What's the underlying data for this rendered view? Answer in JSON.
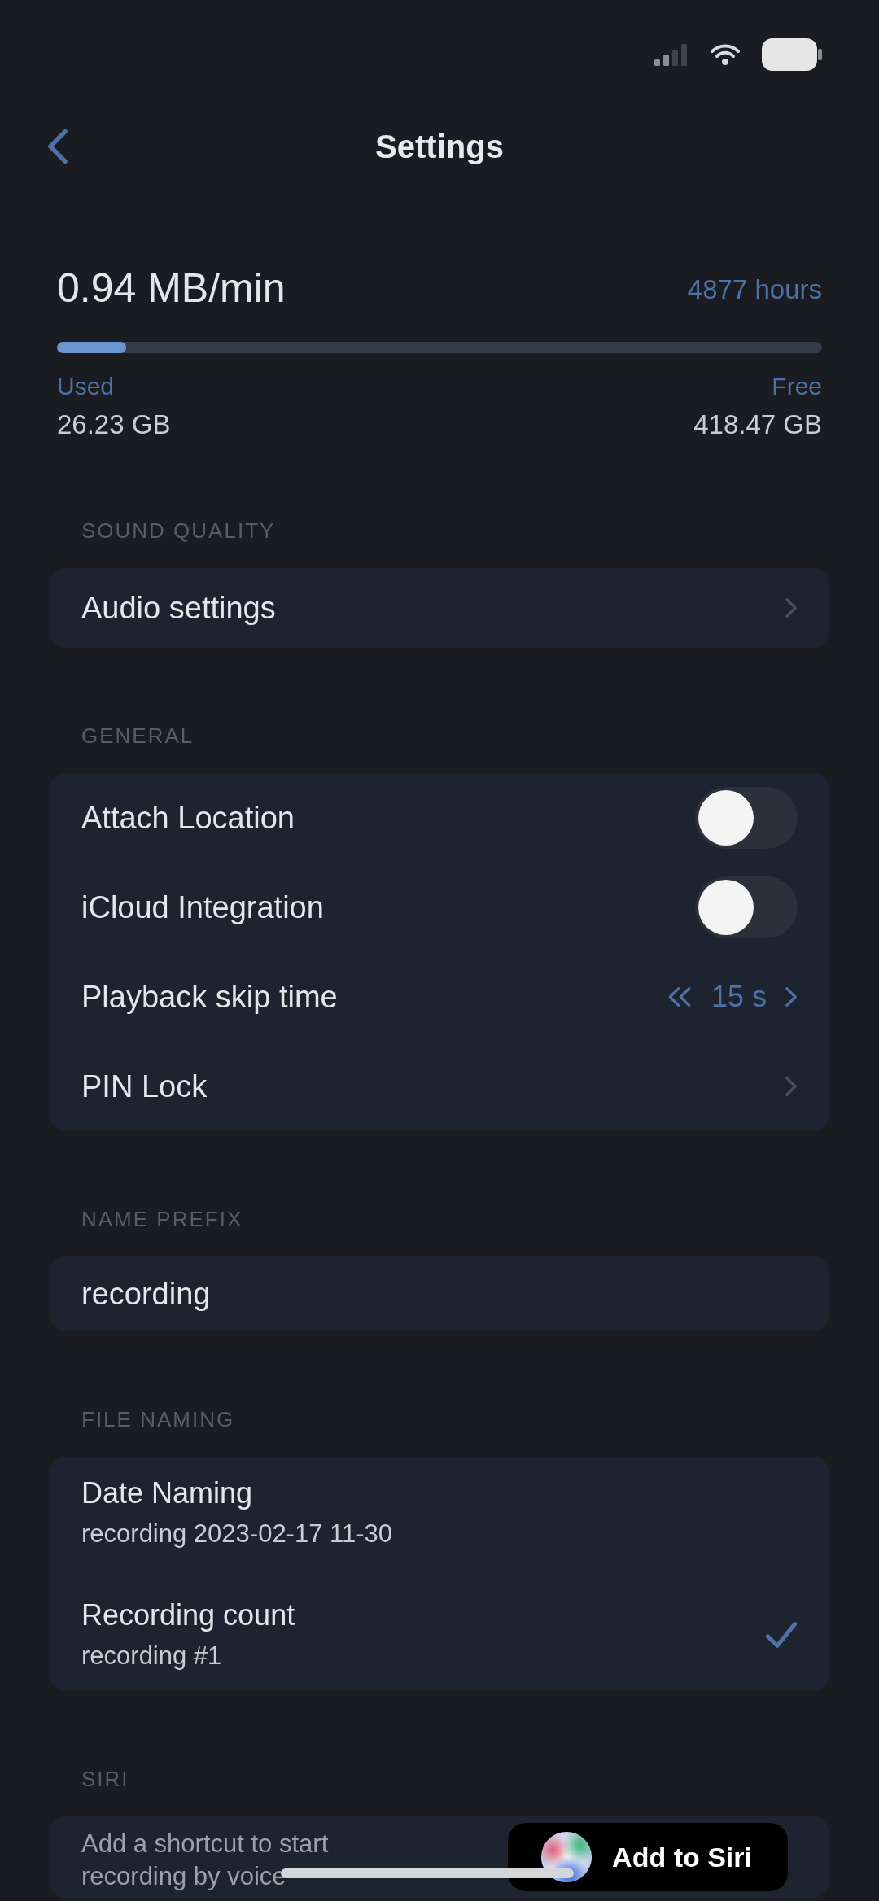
{
  "nav": {
    "title": "Settings"
  },
  "storage": {
    "rate": "0.94 MB/min",
    "remaining": "4877 hours",
    "level": 0.09,
    "used_label": "Used",
    "used_value": "26.23 GB",
    "free_label": "Free",
    "free_value": "418.47 GB"
  },
  "sections": [
    {
      "header": "SOUND QUALITY",
      "rows": [
        {
          "kind": "link",
          "label": "Audio settings"
        }
      ]
    },
    {
      "header": "GENERAL",
      "rows": [
        {
          "kind": "toggle",
          "label": "Attach Location",
          "on": false
        },
        {
          "kind": "toggle",
          "label": "iCloud Integration",
          "on": false
        },
        {
          "kind": "stepper",
          "label": "Playback skip time",
          "value": "15 s"
        },
        {
          "kind": "link",
          "label": "PIN Lock"
        }
      ]
    },
    {
      "header": "NAME PREFIX",
      "rows": [
        {
          "kind": "field",
          "value": "recording"
        }
      ]
    },
    {
      "header": "FILE NAMING",
      "rows": [
        {
          "kind": "option",
          "label": "Date Naming",
          "example": "recording 2023-02-17 11-30",
          "selected": false
        },
        {
          "kind": "option",
          "label": "Recording count",
          "example": "recording #1",
          "selected": true
        }
      ]
    },
    {
      "header": "SIRI",
      "rows": [
        {
          "kind": "siri",
          "label": "Add a shortcut to start",
          "detail": "recording by voice",
          "button": "Add to Siri"
        }
      ]
    }
  ]
}
